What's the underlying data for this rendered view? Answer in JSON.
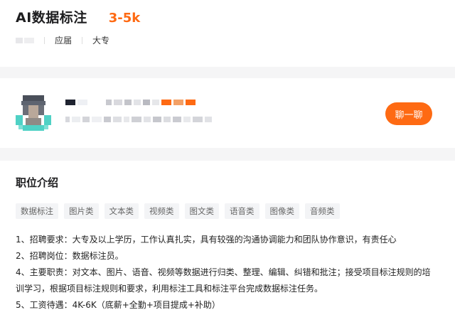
{
  "job": {
    "title": "AI数据标注",
    "salary": "3-5k",
    "meta": [
      "应届",
      "大专"
    ]
  },
  "recruiter": {
    "action_label": "聊一聊"
  },
  "description": {
    "section_title": "职位介绍",
    "tags": [
      "数据标注",
      "图片类",
      "文本类",
      "视频类",
      "图文类",
      "语音类",
      "图像类",
      "音频类"
    ],
    "lines": [
      "1、招聘要求：大专及以上学历，工作认真扎实，具有较强的沟通协调能力和团队协作意识，有责任心",
      "2、招聘岗位：数据标注员。",
      "4、主要职责：对文本、图片、语音、视频等数据进行归类、整理、编辑、纠错和批注；接受项目标注规则的培训学习，根据项目标注规则和要求，利用标注工具和标注平台完成数据标注任务。",
      "5、工资待遇：4K-6K（底薪+全勤+项目提成+补助）"
    ]
  },
  "colors": {
    "accent": "#fe6a13",
    "tag_bg": "#f3f4f6",
    "page_bg": "#f5f5f6"
  }
}
